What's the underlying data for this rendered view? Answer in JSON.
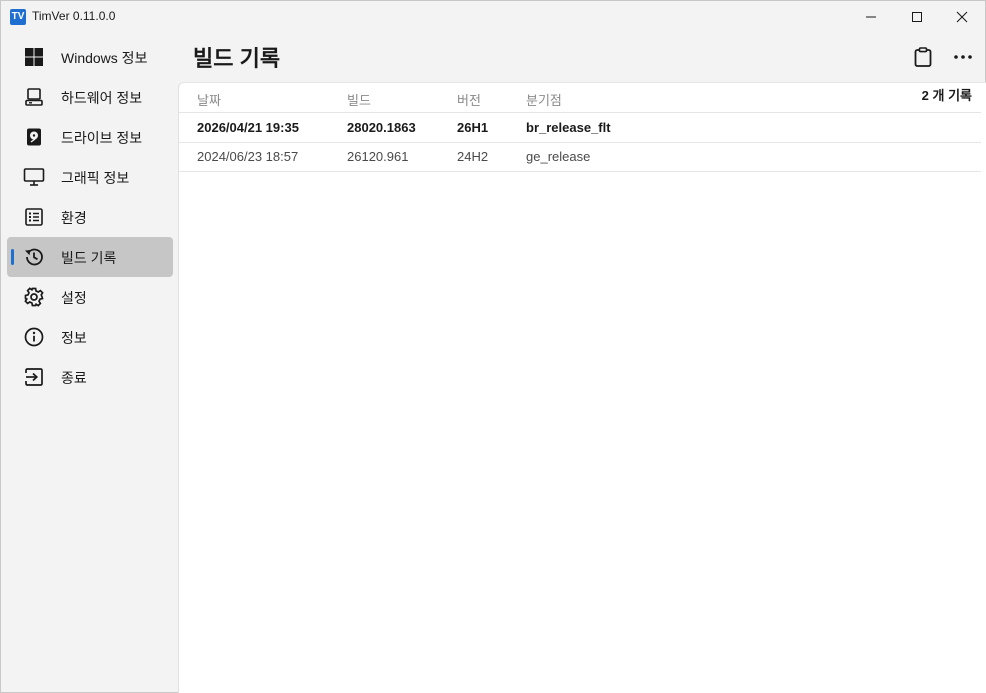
{
  "app": {
    "logo_text": "TV",
    "title": "TimVer  0.11.0.0"
  },
  "sidebar": {
    "items": [
      {
        "label": "Windows 정보",
        "icon": "windows-logo-icon"
      },
      {
        "label": "하드웨어 정보",
        "icon": "computer-icon"
      },
      {
        "label": "드라이브 정보",
        "icon": "hard-drive-icon"
      },
      {
        "label": "그래픽 정보",
        "icon": "monitor-icon"
      },
      {
        "label": "환경",
        "icon": "list-icon"
      },
      {
        "label": "빌드 기록",
        "icon": "history-icon",
        "active": true
      },
      {
        "label": "설정",
        "icon": "gear-icon"
      },
      {
        "label": "정보",
        "icon": "info-icon"
      },
      {
        "label": "종료",
        "icon": "exit-icon"
      }
    ]
  },
  "page": {
    "title": "빌드 기록",
    "record_count": "2 개 기록"
  },
  "table": {
    "columns": [
      "날짜",
      "빌드",
      "버전",
      "분기점"
    ],
    "rows": [
      {
        "date": "2026/04/21 19:35",
        "build": "28020.1863",
        "version": "26H1",
        "branch": "br_release_flt",
        "current": true
      },
      {
        "date": "2024/06/23 18:57",
        "build": "26120.961",
        "version": "24H2",
        "branch": "ge_release",
        "current": false
      }
    ]
  },
  "colors": {
    "accent": "#1f6fd1",
    "selected_bg": "#c6c6c6",
    "window_bg": "#f3f3f3",
    "content_bg": "#ffffff"
  }
}
